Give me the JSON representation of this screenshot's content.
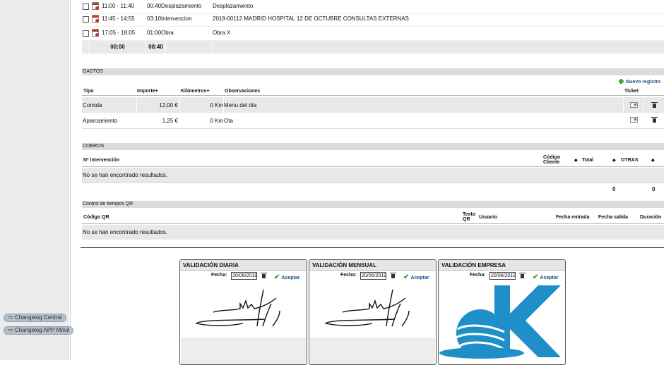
{
  "sidebar": {
    "links": [
      {
        "label": "Changelog Central",
        "icon": "list-icon"
      },
      {
        "label": "Changelog APP Móvil",
        "icon": "list-icon"
      }
    ]
  },
  "time_entries": {
    "rows": [
      {
        "range": "11:00 - 11:40",
        "duration": "00:40",
        "type": "Desplazamiento",
        "description": "Desplazamiento"
      },
      {
        "range": "11:45 - 14:55",
        "duration": "03:10",
        "type": "Intervencion",
        "description": "2019-00112 MADRID HOSPITAL 12 DE OCTUBRE CONSULTAS EXTERNAS"
      },
      {
        "range": "17:05 - 18:05",
        "duration": "01:00",
        "type": "Obra",
        "description": "Obra X"
      }
    ],
    "totals": {
      "a": "00:00",
      "b": "08:40"
    }
  },
  "gastos": {
    "title": "GASTOS",
    "new_record": "Nuevo registro",
    "headers": {
      "tipo": "Tipo",
      "importe": "Importe+",
      "km": "Kilómetros+",
      "obs": "Observaciones",
      "ticket": "Ticket"
    },
    "rows": [
      {
        "tipo": "Comida",
        "importe": "12,00 €",
        "km": "0 Km",
        "obs": "Menu del día"
      },
      {
        "tipo": "Aparcamiento",
        "importe": "1,25 €",
        "km": "0 Km",
        "obs": "Ota"
      }
    ]
  },
  "cobros": {
    "title": "COBROS",
    "headers": {
      "intervencion": "Nº intervención",
      "codigo": "Código Cliente",
      "total": "Total",
      "otras": "OTRAS"
    },
    "empty": "No se han encontrado resultados.",
    "totals": {
      "total": "0",
      "otras": "0"
    }
  },
  "qr": {
    "title": "Control de tiempos QR",
    "headers": {
      "codigo": "Código QR",
      "texto": "Texto QR",
      "usuario": "Usuario",
      "entrada": "Fecha entrada",
      "salida": "Fecha salida",
      "duracion": "Duración"
    },
    "empty": "No se han encontrado resultados."
  },
  "validation": {
    "fecha_label": "Fecha:",
    "accept_label": "Aceptar",
    "cards": [
      {
        "title": "VALIDACIÓN DIARIA",
        "date": "20/06/2019",
        "image": "signature"
      },
      {
        "title": "VALIDACIÓN MENSUAL",
        "date": "20/06/2019",
        "image": "signature"
      },
      {
        "title": "VALIDACIÓN EMPRESA",
        "date": "20/06/2019",
        "image": "company-logo"
      }
    ]
  },
  "colors": {
    "accent": "#1b4f8a",
    "logo_blue": "#1f8fc9"
  }
}
